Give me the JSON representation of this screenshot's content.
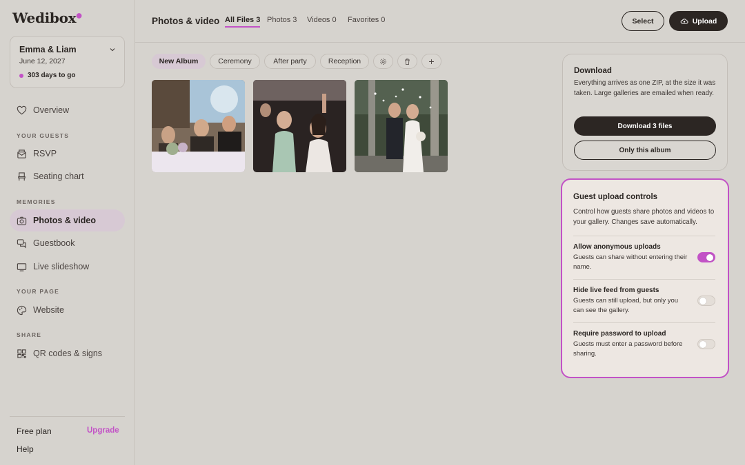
{
  "app": {
    "logo": "Wedibox"
  },
  "event": {
    "name": "Emma & Liam",
    "date": "June 12, 2027",
    "countdown": "303 days to go"
  },
  "nav": {
    "overview": "Overview",
    "sections": {
      "guests": "YOUR GUESTS",
      "memories": "MEMORIES",
      "page": "YOUR PAGE",
      "share": "SHARE"
    },
    "rsvp": "RSVP",
    "seating": "Seating chart",
    "photos": "Photos & video",
    "guestbook": "Guestbook",
    "slideshow": "Live slideshow",
    "website": "Website",
    "qr": "QR codes & signs"
  },
  "plan": {
    "label": "Free plan",
    "upgrade": "Upgrade",
    "help": "Help"
  },
  "header": {
    "title": "Photos & video",
    "tabs": {
      "all": "All Files 3",
      "photos": "Photos 3",
      "videos": "Videos 0",
      "favorites": "Favorites 0"
    },
    "select": "Select",
    "upload": "Upload"
  },
  "albums": {
    "new": "New Album",
    "ceremony": "Ceremony",
    "after_party": "After party",
    "reception": "Reception"
  },
  "download": {
    "title": "Download",
    "description": "Everything arrives as one ZIP, at the size it was taken. Large galleries are emailed when ready.",
    "download_all": "Download 3 files",
    "only_album": "Only this album"
  },
  "guest_controls": {
    "title": "Guest upload controls",
    "description": "Control how guests share photos and videos to your gallery. Changes save automatically.",
    "settings": [
      {
        "title": "Allow anonymous uploads",
        "description": "Guests can share without entering their name.",
        "enabled": true
      },
      {
        "title": "Hide live feed from guests",
        "description": "Guests can still upload, but only you can see the gallery.",
        "enabled": false
      },
      {
        "title": "Require password to upload",
        "description": "Guests must enter a password before sharing.",
        "enabled": false
      }
    ]
  },
  "colors": {
    "accent": "#c252c6",
    "dark": "#2c2623",
    "background": "#d6d3ce"
  }
}
